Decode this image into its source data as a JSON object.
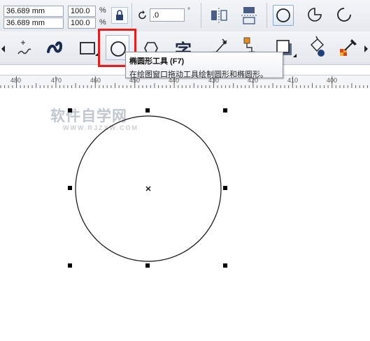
{
  "property_bar": {
    "width_value": "36.689 mm",
    "height_value": "36.689 mm",
    "scale_x": "100.0",
    "scale_y": "100.0",
    "percent_x": "%",
    "percent_y": "%",
    "rotation_value": ".0",
    "degree_symbol": "°",
    "icons": [
      "lock-icon",
      "rotate-icon",
      "mirror-horizontal-icon",
      "mirror-vertical-icon",
      "ellipse-mode-icon",
      "pie-mode-icon",
      "arc-mode-icon"
    ]
  },
  "toolbox": {
    "tools": [
      "freehand-tool-icon",
      "smart-drawing-tool-icon",
      "artistic-media-tool-icon",
      "rectangle-tool-icon",
      "ellipse-tool-icon",
      "polygon-tool-icon",
      "text-tool-icon",
      "dimension-tool-icon",
      "connector-tool-icon",
      "shadow-tool-icon",
      "fill-tool-icon",
      "eyedropper-tool-icon"
    ],
    "text_tool_glyph": "字"
  },
  "ruler": {
    "labels": [
      "480",
      "470",
      "460",
      "450",
      "440",
      "430",
      "420",
      "410",
      "400"
    ]
  },
  "tooltip": {
    "title": "椭圆形工具 (F7)",
    "description": "在绘图窗口拖动工具绘制圆形和椭圆形。"
  },
  "canvas": {
    "watermark": "软件自学网",
    "watermark_url": "WWW.RJZXW.COM",
    "shape": "circle",
    "selected": true
  },
  "colors": {
    "highlight": "#e02020",
    "toolbar_bg": "#eef1f5"
  }
}
